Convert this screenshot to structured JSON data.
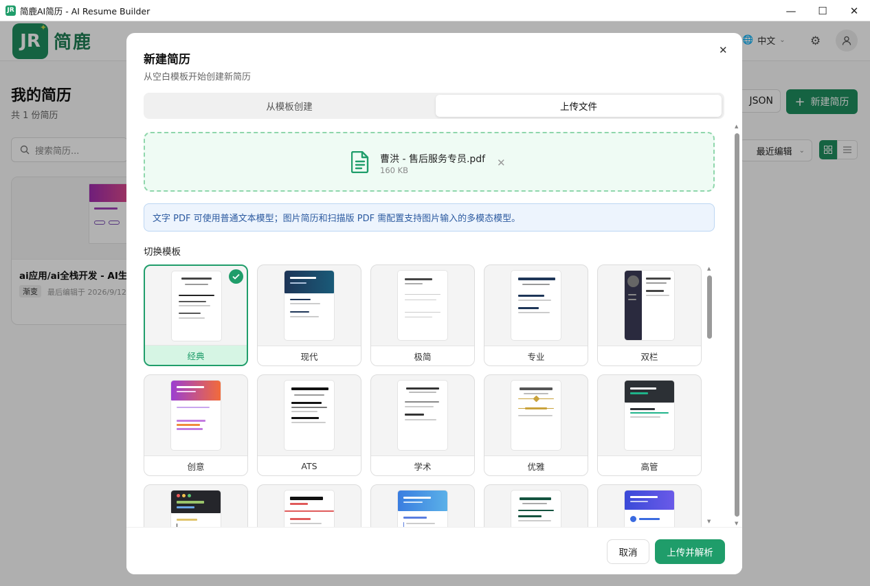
{
  "window": {
    "title": "简鹿AI简历 - AI Resume Builder",
    "app_icon": "JR"
  },
  "header": {
    "logo_text": "简鹿",
    "logo_mark": "JR",
    "language": "中文"
  },
  "page": {
    "title": "我的简历",
    "subtitle": "共 1 份简历",
    "import_label": "JSON",
    "new_label": "新建简历",
    "search_placeholder": "搜索简历...",
    "sort_label": "最近编辑"
  },
  "resume_card": {
    "title": "ai应用/ai全栈开发 - AI生",
    "tag": "渐变",
    "edited": "最后编辑于 2026/9/12"
  },
  "modal": {
    "title": "新建简历",
    "subtitle": "从空白模板开始创建新简历",
    "tabs": [
      "从模板创建",
      "上传文件"
    ],
    "active_tab": "上传文件",
    "file": {
      "name": "曹洪 - 售后服务专员.pdf",
      "size": "160 KB"
    },
    "info": "文字 PDF 可使用普通文本模型；图片简历和扫描版 PDF 需配置支持图片输入的多模态模型。",
    "section_label": "切换模板",
    "templates": [
      "经典",
      "现代",
      "极简",
      "专业",
      "双栏",
      "创意",
      "ATS",
      "学术",
      "优雅",
      "高管",
      "",
      "",
      "",
      "",
      ""
    ],
    "selected_template": "经典",
    "cancel_label": "取消",
    "submit_label": "上传并解析"
  },
  "colors": {
    "brand": "#1f9d6a",
    "info_text": "#2c5aa0",
    "dropzone_border": "#8ed6ab"
  }
}
